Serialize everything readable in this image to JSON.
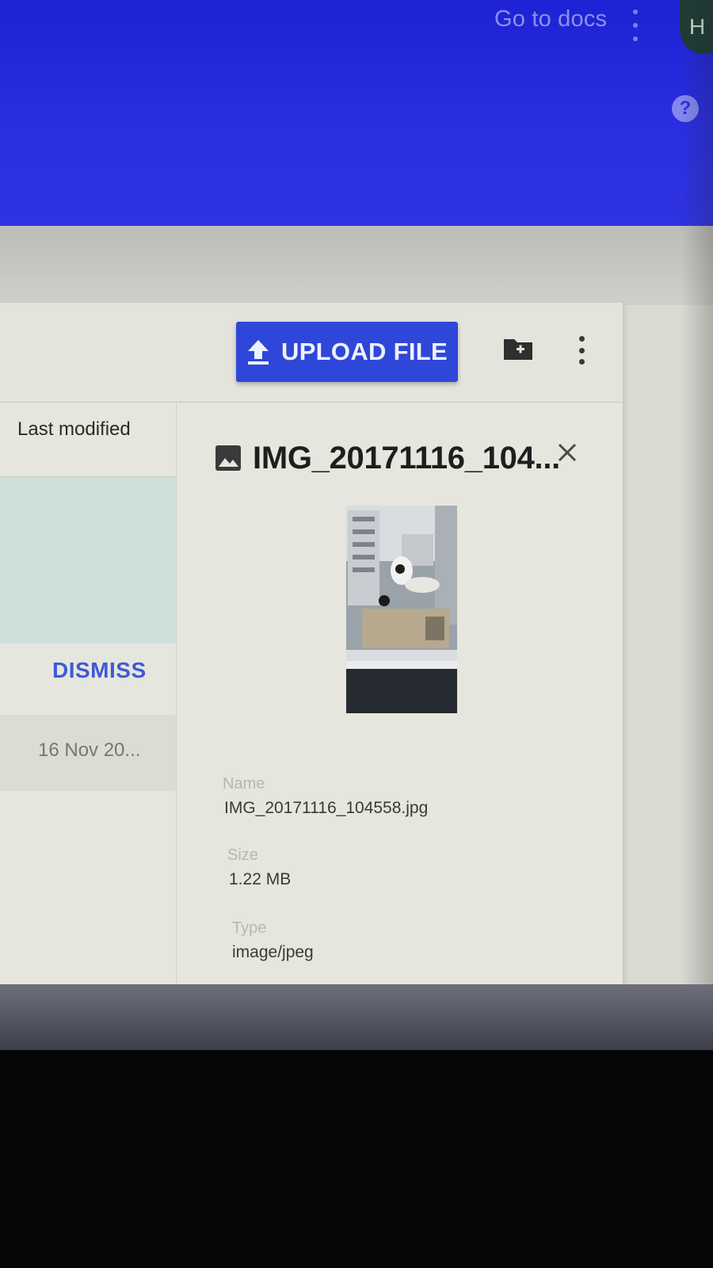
{
  "app_bar": {
    "docs_link": "Go to docs",
    "avatar_initial": "H",
    "help_glyph": "?",
    "color": "#2a2ee0"
  },
  "toolbar": {
    "upload_label": "UPLOAD FILE",
    "upload_icon": "upload-arrow-icon",
    "new_folder_icon": "create-new-folder-icon",
    "more_icon": "more-vert-icon",
    "accent": "#2e47d8"
  },
  "file_list": {
    "column_header": "Last modified",
    "dismiss_label": "DISMISS",
    "row_date": "16 Nov 20..."
  },
  "details": {
    "title": "IMG_20171116_104...",
    "title_icon": "image-icon",
    "close_icon": "close-icon",
    "fields": [
      {
        "label": "Name",
        "value": "IMG_20171116_104558.jpg"
      },
      {
        "label": "Size",
        "value": "1.22 MB"
      },
      {
        "label": "Type",
        "value": "image/jpeg"
      }
    ]
  }
}
